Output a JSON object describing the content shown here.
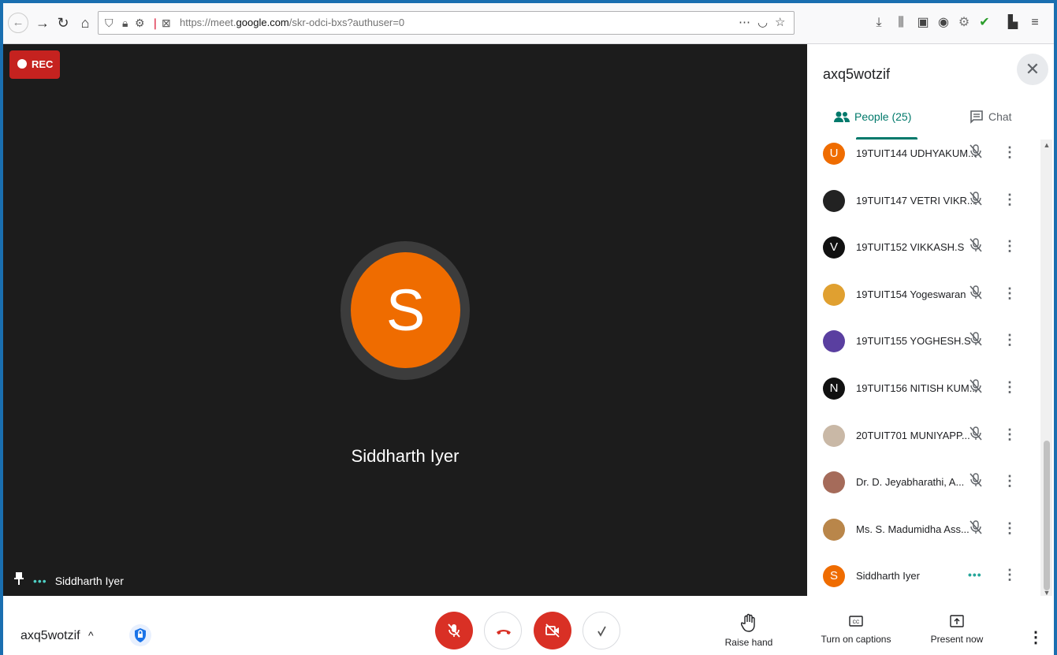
{
  "browser": {
    "url_prefix": "https://meet.",
    "url_domain": "google.com",
    "url_path": "/skr-odci-bxs?authuser=0"
  },
  "stage": {
    "rec_label": "REC",
    "avatar_letter": "S",
    "speaker_name": "Siddharth Iyer",
    "self_name": "Siddharth Iyer",
    "avatar_color": "#ef6c00"
  },
  "panel": {
    "title": "axq5wotzif",
    "people_tab": "People (25)",
    "chat_tab": "Chat",
    "accent": "#00796b",
    "participants": [
      {
        "name": "19TUIT144 UDHYAKUM...",
        "avatar": "U",
        "color": "#ef6c00",
        "status": "muted"
      },
      {
        "name": "19TUIT147 VETRI VIKR...",
        "avatar": "",
        "color": "#222222",
        "status": "muted"
      },
      {
        "name": "19TUIT152 VIKKASH.S",
        "avatar": "V",
        "color": "#111111",
        "status": "muted"
      },
      {
        "name": "19TUIT154 Yogeswaran",
        "avatar": "",
        "color": "#e0a030",
        "status": "muted"
      },
      {
        "name": "19TUIT155 YOGHESH.S",
        "avatar": "",
        "color": "#5a3fa0",
        "status": "muted"
      },
      {
        "name": "19TUIT156 NITISH KUM...",
        "avatar": "N",
        "color": "#111111",
        "status": "muted"
      },
      {
        "name": "20TUIT701 MUNIYAPP...",
        "avatar": "",
        "color": "#c9b8a6",
        "status": "muted"
      },
      {
        "name": "Dr. D. Jeyabharathi, A...",
        "avatar": "",
        "color": "#a56b5a",
        "status": "muted"
      },
      {
        "name": "Ms. S. Madumidha Ass...",
        "avatar": "",
        "color": "#b9864a",
        "status": "muted"
      },
      {
        "name": "Siddharth Iyer",
        "avatar": "S",
        "color": "#ef6c00",
        "status": "speaking"
      }
    ]
  },
  "bottom": {
    "meeting_code": "axq5wotzif",
    "raise_hand": "Raise hand",
    "captions": "Turn on captions",
    "present": "Present now"
  }
}
